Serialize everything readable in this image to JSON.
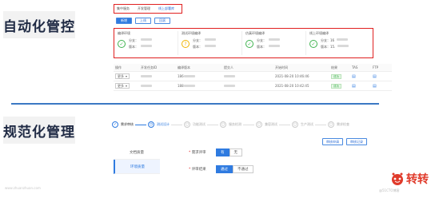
{
  "labels": {
    "auto": "自动化管控",
    "norm": "规范化管理"
  },
  "tabs": [
    {
      "label": "集中服务"
    },
    {
      "label": "开发管理"
    },
    {
      "label": "线上部署库"
    }
  ],
  "toolbar": {
    "new": "新增",
    "deploy": "上线",
    "delete": "回滚"
  },
  "envs": [
    {
      "title": "编译环境",
      "status": "ok",
      "line1": "分支：",
      "line2": "版本："
    },
    {
      "title": "测试环境编译",
      "status": "warn",
      "line1": "分支：",
      "line2": "版本："
    },
    {
      "title": "仿真环境编译",
      "status": "ok",
      "line1": "分支：",
      "line2": "版本："
    },
    {
      "title": "线上环境编译",
      "status": "ok",
      "line1": "分支：16",
      "line2": "版本：15."
    }
  ],
  "table": {
    "headers": [
      "操作",
      "开发任务ID",
      "编译版本",
      "提交人",
      "开始时间",
      "结果",
      "TAS",
      "FTP"
    ],
    "rows": [
      {
        "action": "更多",
        "id": "",
        "build": "186",
        "user": "",
        "time": "2021-08-20 10:46:46",
        "result": "成功"
      },
      {
        "action": "更多",
        "id": "",
        "build": "188",
        "user": "",
        "time": "2021-08-20 10:42:45",
        "result": "成功"
      }
    ]
  },
  "steps": [
    {
      "label": "需求审核",
      "state": "done"
    },
    {
      "label": "测试设计",
      "state": "current"
    },
    {
      "label": "功能测试",
      "state": "todo"
    },
    {
      "label": "服务检测",
      "state": "todo"
    },
    {
      "label": "兼容测试",
      "state": "todo"
    },
    {
      "label": "生产测试",
      "state": "todo"
    },
    {
      "label": "需求检查",
      "state": "todo"
    }
  ],
  "actions": {
    "submit": "审核申请",
    "record": "审核记录"
  },
  "sidenav": [
    {
      "label": "文档质量",
      "active": false
    },
    {
      "label": "环境质量",
      "active": true
    }
  ],
  "form": {
    "row1": {
      "label": "需求评审",
      "options": [
        "有",
        "无"
      ],
      "selected": 0
    },
    "row2": {
      "label": "评审结果",
      "options": [
        "通过",
        "不通过"
      ],
      "selected": 0
    }
  },
  "watermark": "www.zhuanzhuan.com",
  "logo": {
    "text": "转转",
    "sub": "@51CTO博客"
  }
}
